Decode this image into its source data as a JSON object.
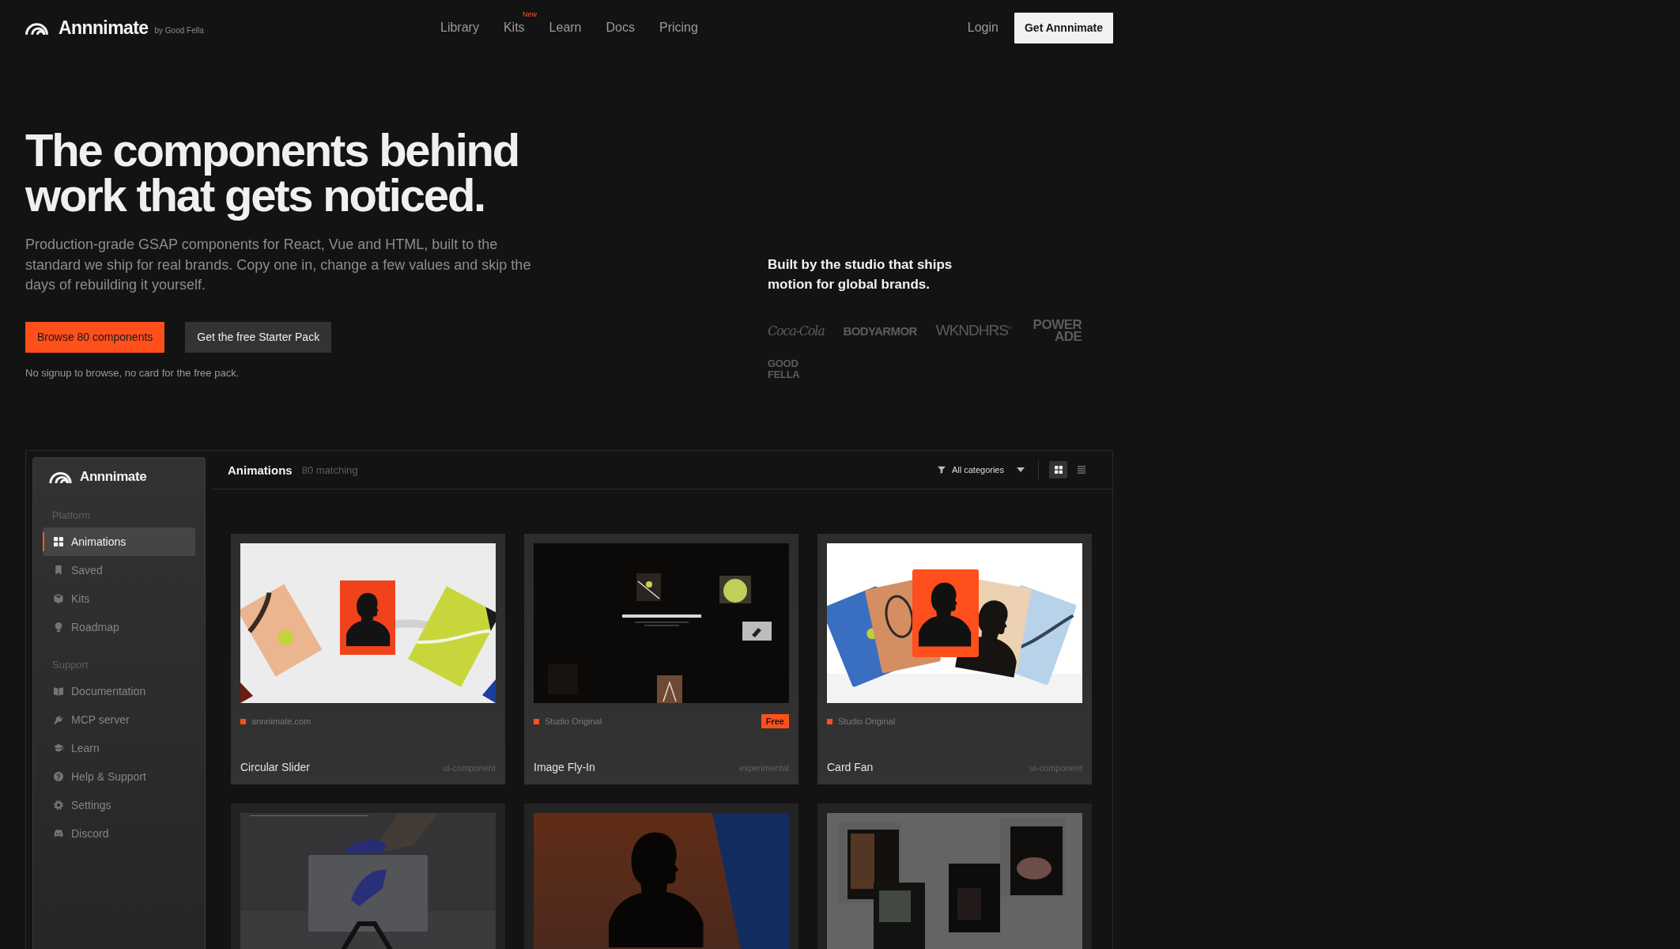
{
  "header": {
    "logo": {
      "name": "Annnimate",
      "byline": "by Good Fella"
    },
    "nav": [
      {
        "label": "Library"
      },
      {
        "label": "Kits",
        "badge": "New"
      },
      {
        "label": "Learn"
      },
      {
        "label": "Docs"
      },
      {
        "label": "Pricing"
      }
    ],
    "login": "Login",
    "cta": "Get Annnimate"
  },
  "hero": {
    "headline": "The components behind work that gets noticed.",
    "description": "Production-grade GSAP components for React, Vue and HTML, built to the standard we ship for real brands. Copy one in, change a few values and skip the days of rebuilding it yourself.",
    "buttons": [
      {
        "label": "Browse 80 components",
        "kind": "primary"
      },
      {
        "label": "Get the free Starter Pack",
        "kind": "secondary"
      }
    ],
    "note": "No signup to browse, no card for the free pack."
  },
  "clients": {
    "tagline": "Built by the studio that ships motion for global brands.",
    "logos": [
      {
        "text": "Coca-Cola",
        "kind": "script"
      },
      {
        "text": "BODYARMOR",
        "kind": "block"
      },
      {
        "text": "WKNDHRS$^{®}$",
        "kind": "thin"
      },
      {
        "text": "POWER ADE",
        "kind": "stacked"
      },
      {
        "text": "GOOD FELLA",
        "kind": "pixel"
      }
    ]
  },
  "app": {
    "sidebar": {
      "title": "Annnimate",
      "sections": [
        {
          "label": "Platform",
          "items": [
            {
              "label": "Animations",
              "selected": true
            },
            {
              "label": "Saved",
              "selected": false
            },
            {
              "label": "Kits",
              "selected": false
            },
            {
              "label": "Roadmap",
              "selected": false
            }
          ]
        },
        {
          "label": "Support",
          "items": [
            {
              "label": "Documentation",
              "selected": false
            },
            {
              "label": "MCP server",
              "selected": false
            },
            {
              "label": "Learn",
              "selected": false
            },
            {
              "label": "Help & Support",
              "selected": false
            },
            {
              "label": "Settings",
              "selected": false
            },
            {
              "label": "Discord",
              "selected": false
            }
          ]
        }
      ]
    },
    "toolbar": {
      "title": "Animations",
      "count": "80 matching",
      "filter": "All categories",
      "views": [
        {
          "selected": true
        },
        {
          "selected": false
        }
      ]
    },
    "cards": [
      {
        "kind": "slider",
        "source": "annnimate.com",
        "title": "Circular Slider",
        "tag": "ui-component"
      },
      {
        "kind": "flyin",
        "source": "Studio Original",
        "badge": "Free",
        "title": "Image Fly-In",
        "tag": "experimental"
      },
      {
        "kind": "fan",
        "source": "Studio Original",
        "title": "Card Fan",
        "tag": "ui-component"
      },
      {
        "kind": "football"
      },
      {
        "kind": "portrait"
      },
      {
        "kind": "posters"
      }
    ]
  }
}
